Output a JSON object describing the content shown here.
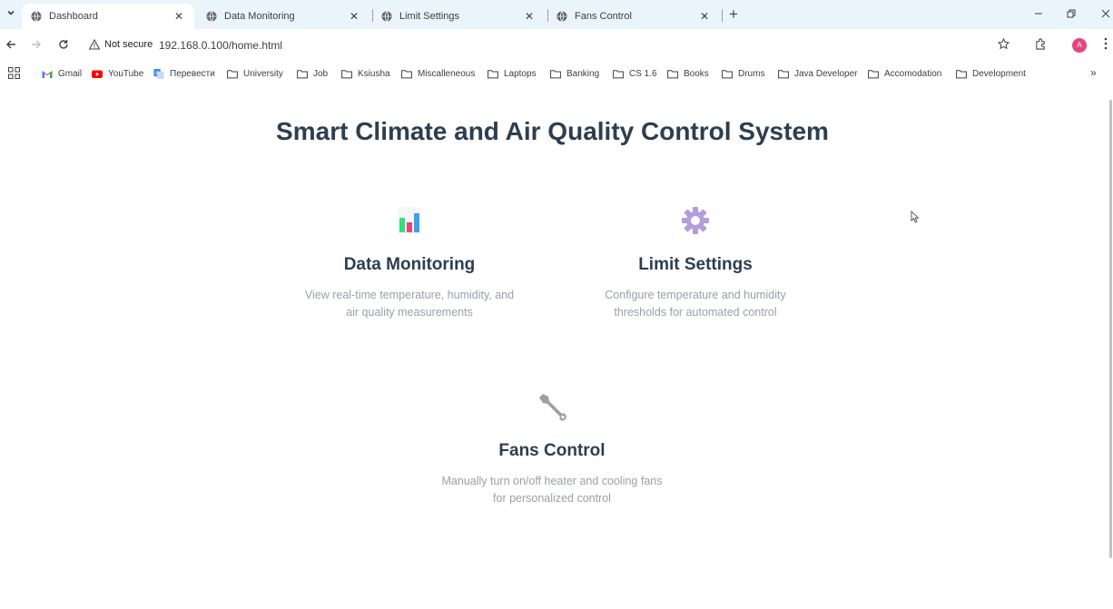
{
  "browser": {
    "tabs": [
      {
        "title": "Dashboard",
        "active": true
      },
      {
        "title": "Data Monitoring",
        "active": false
      },
      {
        "title": "Limit Settings",
        "active": false
      },
      {
        "title": "Fans Control",
        "active": false
      }
    ],
    "security_label": "Not secure",
    "url": "192.168.0.100/home.html",
    "profile_initial": "A",
    "profile_color": "#e8457c",
    "bookmarks": [
      {
        "label": "Gmail",
        "icon": "gmail-icon"
      },
      {
        "label": "YouTube",
        "icon": "youtube-icon"
      },
      {
        "label": "Перевести",
        "icon": "translate-icon"
      },
      {
        "label": "University",
        "icon": "folder-icon"
      },
      {
        "label": "Job",
        "icon": "folder-icon"
      },
      {
        "label": "Ksiusha",
        "icon": "folder-icon"
      },
      {
        "label": "Miscalleneous",
        "icon": "folder-icon"
      },
      {
        "label": "Laptops",
        "icon": "folder-icon"
      },
      {
        "label": "Banking",
        "icon": "folder-icon"
      },
      {
        "label": "CS 1.6",
        "icon": "folder-icon"
      },
      {
        "label": "Books",
        "icon": "folder-icon"
      },
      {
        "label": "Drums",
        "icon": "folder-icon"
      },
      {
        "label": "Java Developer",
        "icon": "folder-icon"
      },
      {
        "label": "Accomodation",
        "icon": "folder-icon"
      },
      {
        "label": "Development",
        "icon": "folder-icon"
      }
    ]
  },
  "page": {
    "title": "Smart Climate and Air Quality Control System",
    "cards": [
      {
        "icon": "bar-chart-icon",
        "title": "Data Monitoring",
        "description": "View real-time temperature, humidity, and air quality measurements"
      },
      {
        "icon": "gear-icon",
        "title": "Limit Settings",
        "description": "Configure temperature and humidity thresholds for automated control"
      },
      {
        "icon": "wrench-icon",
        "title": "Fans Control",
        "description": "Manually turn on/off heater and cooling fans for personalized control"
      }
    ]
  },
  "colors": {
    "heading": "#2c3e50",
    "description": "#9aa0a6",
    "tabstrip": "#e9f4fb"
  }
}
